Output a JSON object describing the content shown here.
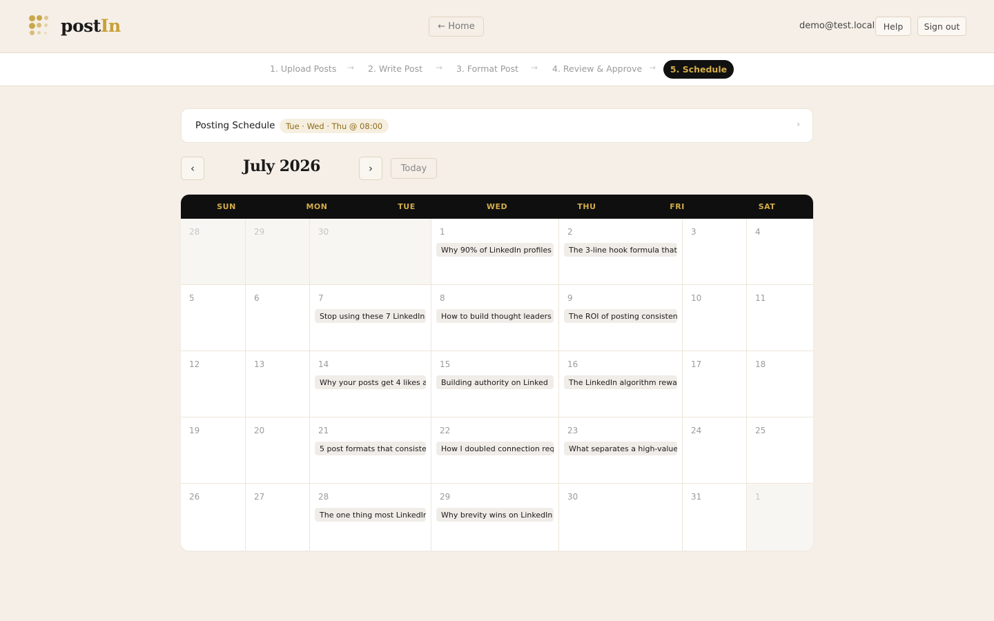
{
  "header": {
    "logo_text_a": "post",
    "logo_text_b": "In",
    "home_label": "← Home",
    "user_email": "demo@test.local",
    "help_label": "Help",
    "signout_label": "Sign out"
  },
  "steps": [
    {
      "label": "1. Upload Posts"
    },
    {
      "label": "2. Write Post"
    },
    {
      "label": "3. Format Post"
    },
    {
      "label": "4. Review & Approve"
    },
    {
      "label": "5. Schedule"
    }
  ],
  "step_arrow": "→",
  "schedule": {
    "title": "Posting Schedule",
    "badge": "Tue · Wed · Thu @ 08:00",
    "chevron": "›"
  },
  "calendar_nav": {
    "prev": "‹",
    "next": "›",
    "month": "July 2026",
    "today": "Today"
  },
  "weekdays": [
    "SUN",
    "MON",
    "TUE",
    "WED",
    "THU",
    "FRI",
    "SAT"
  ],
  "weeks": [
    [
      {
        "day": "28",
        "muted": true
      },
      {
        "day": "29",
        "muted": true
      },
      {
        "day": "30",
        "muted": true
      },
      {
        "day": "1",
        "post": "Why 90% of LinkedIn profiles"
      },
      {
        "day": "2",
        "post": "The 3-line hook formula that"
      },
      {
        "day": "3"
      },
      {
        "day": "4"
      }
    ],
    [
      {
        "day": "5"
      },
      {
        "day": "6"
      },
      {
        "day": "7",
        "post": "Stop using these 7 LinkedIn"
      },
      {
        "day": "8",
        "post": "How to build thought leaders"
      },
      {
        "day": "9",
        "post": "The ROI of posting consisten"
      },
      {
        "day": "10"
      },
      {
        "day": "11"
      }
    ],
    [
      {
        "day": "12"
      },
      {
        "day": "13"
      },
      {
        "day": "14",
        "post": "Why your posts get 4 likes a"
      },
      {
        "day": "15",
        "post": "Building authority on Linked"
      },
      {
        "day": "16",
        "post": "The LinkedIn algorithm rewar"
      },
      {
        "day": "17"
      },
      {
        "day": "18"
      }
    ],
    [
      {
        "day": "19"
      },
      {
        "day": "20"
      },
      {
        "day": "21",
        "post": "5 post formats that consiste"
      },
      {
        "day": "22",
        "post": "How I doubled connection req"
      },
      {
        "day": "23",
        "post": "What separates a high-value"
      },
      {
        "day": "24"
      },
      {
        "day": "25"
      }
    ],
    [
      {
        "day": "26"
      },
      {
        "day": "27"
      },
      {
        "day": "28",
        "post": "The one thing most LinkedIn"
      },
      {
        "day": "29",
        "post": "Why brevity wins on LinkedIn"
      },
      {
        "day": "30"
      },
      {
        "day": "31"
      },
      {
        "day": "1",
        "muted": true
      }
    ]
  ],
  "colors": {
    "background": "#f5efe7",
    "accent_gold": "#d4ad4a",
    "header_dark": "#0f0f0f"
  }
}
